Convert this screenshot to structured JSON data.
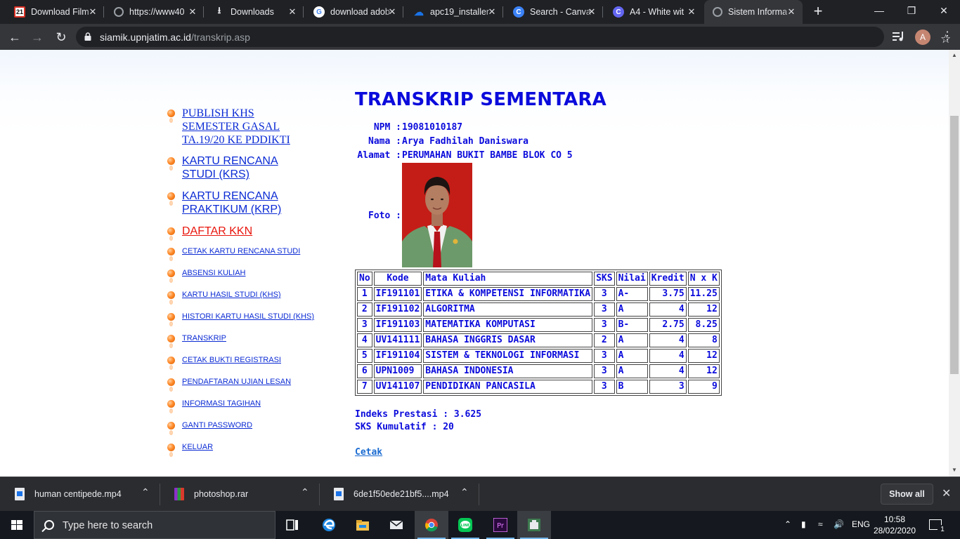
{
  "browser": {
    "tabs": [
      {
        "title": "Download Film",
        "favicon": "21",
        "favicon_color": "#d93025"
      },
      {
        "title": "https://www40",
        "favicon": "globe",
        "favicon_color": "#9aa0a6"
      },
      {
        "title": "Downloads",
        "favicon": "download",
        "favicon_color": "#e8eaed"
      },
      {
        "title": "download adob",
        "favicon": "G",
        "favicon_color": "#4285f4"
      },
      {
        "title": "apc19_installer",
        "favicon": "cloud",
        "favicon_color": "#1a73e8"
      },
      {
        "title": "Search - Canva",
        "favicon": "C",
        "favicon_color": "#3b82f6"
      },
      {
        "title": "A4 - White wit",
        "favicon": "C",
        "favicon_color": "#6366f1"
      },
      {
        "title": "Sistem Informa",
        "favicon": "globe",
        "favicon_color": "#9aa0a6",
        "active": true
      }
    ],
    "new_tab_label": "+",
    "url_host": "siamik.upnjatim.ac.id",
    "url_path": "/transkrip.asp",
    "avatar_letter": "A"
  },
  "sidebar": {
    "items": [
      {
        "label_lines": [
          "PUBLISH KHS",
          "SEMESTER GASAL",
          "TA.19/20 KE PDDIKTI"
        ],
        "style": "serif"
      },
      {
        "label_lines": [
          "KARTU RENCANA",
          "STUDI (KRS)"
        ],
        "style": "big"
      },
      {
        "label_lines": [
          "KARTU RENCANA",
          "PRAKTIKUM (KRP)"
        ],
        "style": "big"
      },
      {
        "label_lines": [
          "DAFTAR KKN"
        ],
        "style": "big-red"
      },
      {
        "label_lines": [
          "CETAK KARTU RENCANA STUDI"
        ],
        "style": "small"
      },
      {
        "label_lines": [
          "ABSENSI KULIAH"
        ],
        "style": "small"
      },
      {
        "label_lines": [
          "KARTU HASIL STUDI (KHS)"
        ],
        "style": "small"
      },
      {
        "label_lines": [
          "HISTORI KARTU HASIL STUDI (KHS)"
        ],
        "style": "small"
      },
      {
        "label_lines": [
          "TRANSKRIP"
        ],
        "style": "small"
      },
      {
        "label_lines": [
          "CETAK BUKTI REGISTRASI"
        ],
        "style": "small"
      },
      {
        "label_lines": [
          "PENDAFTARAN UJIAN LESAN"
        ],
        "style": "small"
      },
      {
        "label_lines": [
          "INFORMASI TAGIHAN"
        ],
        "style": "small"
      },
      {
        "label_lines": [
          "GANTI PASSWORD"
        ],
        "style": "small"
      },
      {
        "label_lines": [
          "KELUAR"
        ],
        "style": "small"
      }
    ]
  },
  "transcript": {
    "title": "TRANSKRIP SEMENTARA",
    "npm_label": "NPM :",
    "npm": "19081010187",
    "name_label": "Nama :",
    "name": "Arya Fadhilah Daniswara",
    "address_label": "Alamat :",
    "address": "PERUMAHAN BUKIT BAMBE BLOK CO 5",
    "photo_label": "Foto :",
    "columns": [
      "No",
      "Kode",
      "Mata Kuliah",
      "SKS",
      "Nilai",
      "Kredit",
      "N x K"
    ],
    "rows": [
      [
        "1",
        "IF191101",
        "ETIKA & KOMPETENSI INFORMATIKA",
        "3",
        "A-",
        "3.75",
        "11.25"
      ],
      [
        "2",
        "IF191102",
        "ALGORITMA",
        "3",
        "A",
        "4",
        "12"
      ],
      [
        "3",
        "IF191103",
        "MATEMATIKA KOMPUTASI",
        "3",
        "B-",
        "2.75",
        "8.25"
      ],
      [
        "4",
        "UV141111",
        "BAHASA INGGRIS DASAR",
        "2",
        "A",
        "4",
        "8"
      ],
      [
        "5",
        "IF191104",
        "SISTEM & TEKNOLOGI INFORMASI",
        "3",
        "A",
        "4",
        "12"
      ],
      [
        "6",
        "UPN1009",
        "BAHASA INDONESIA",
        "3",
        "A",
        "4",
        "12"
      ],
      [
        "7",
        "UV141107",
        "PENDIDIKAN PANCASILA",
        "3",
        "B",
        "3",
        "9"
      ]
    ],
    "ip_label": "Indeks Prestasi :",
    "ip_value": "3.625",
    "sks_label": "SKS Kumulatif :",
    "sks_value": "20",
    "print_label": "Cetak"
  },
  "downloads": {
    "items": [
      {
        "name": "human centipede.mp4",
        "type": "video"
      },
      {
        "name": "photoshop.rar",
        "type": "rar"
      },
      {
        "name": "6de1f50ede21bf5....mp4",
        "type": "video"
      }
    ],
    "show_all_label": "Show all"
  },
  "taskbar": {
    "search_placeholder": "Type here to search",
    "apps": [
      "task-view",
      "edge",
      "file-explorer",
      "mail",
      "chrome",
      "line",
      "premiere",
      "app"
    ],
    "language": "ENG",
    "time": "10:58",
    "date": "28/02/2020",
    "notification_count": "1"
  }
}
